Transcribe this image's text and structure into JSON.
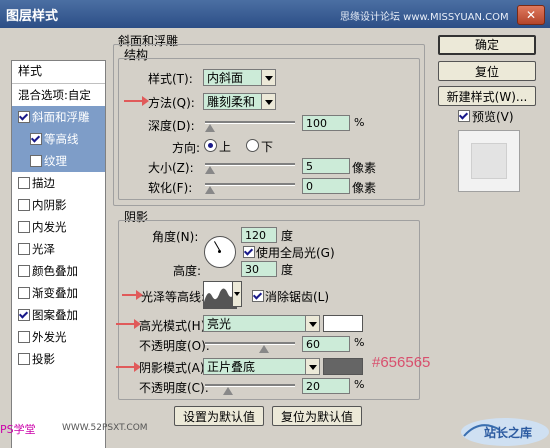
{
  "window": {
    "title": "图层样式",
    "watermark": "思缘设计论坛 www.MISSYUAN.COM"
  },
  "stylelist": {
    "header": "样式",
    "blend_options": "混合选项:自定",
    "items": [
      {
        "label": "斜面和浮雕",
        "checked": true,
        "selected": true,
        "sub": false
      },
      {
        "label": "等高线",
        "checked": true,
        "selected": true,
        "sub": true
      },
      {
        "label": "纹理",
        "checked": false,
        "selected": true,
        "sub": true
      },
      {
        "label": "描边",
        "checked": false,
        "selected": false,
        "sub": false
      },
      {
        "label": "内阴影",
        "checked": false,
        "selected": false,
        "sub": false
      },
      {
        "label": "内发光",
        "checked": false,
        "selected": false,
        "sub": false
      },
      {
        "label": "光泽",
        "checked": false,
        "selected": false,
        "sub": false
      },
      {
        "label": "颜色叠加",
        "checked": false,
        "selected": false,
        "sub": false
      },
      {
        "label": "渐变叠加",
        "checked": false,
        "selected": false,
        "sub": false
      },
      {
        "label": "图案叠加",
        "checked": true,
        "selected": false,
        "sub": false
      },
      {
        "label": "外发光",
        "checked": false,
        "selected": false,
        "sub": false
      },
      {
        "label": "投影",
        "checked": false,
        "selected": false,
        "sub": false
      }
    ]
  },
  "bevel": {
    "section_title": "斜面和浮雕",
    "structure_title": "结构",
    "style_label": "样式(T):",
    "style_value": "内斜面",
    "method_label": "方法(Q):",
    "method_value": "雕刻柔和",
    "depth_label": "深度(D):",
    "depth_value": "100",
    "depth_unit": "%",
    "depth_level": 0.1,
    "direction_label": "方向:",
    "direction_up": "上",
    "direction_down": "下",
    "size_label": "大小(Z):",
    "size_value": "5",
    "size_unit": "像素",
    "soften_label": "软化(F):",
    "soften_value": "0",
    "soften_unit": "像素"
  },
  "shading": {
    "title": "阴影",
    "angle_label": "角度(N):",
    "angle_value": "120",
    "angle_unit": "度",
    "global_light_label": "使用全局光(G)",
    "altitude_label": "高度:",
    "altitude_value": "30",
    "altitude_unit": "度",
    "gloss_contour_label": "光泽等高线:",
    "antialias_label": "消除锯齿(L)",
    "highlight_mode_label": "高光模式(H):",
    "highlight_mode_value": "亮光",
    "highlight_color": "#ffffff",
    "highlight_opacity_label": "不透明度(O):",
    "highlight_opacity_value": "60",
    "shadow_mode_label": "阴影模式(A):",
    "shadow_mode_value": "正片叠底",
    "shadow_color": "#656565",
    "shadow_color_annotation": "#656565",
    "shadow_opacity_label": "不透明度(C):",
    "shadow_opacity_value": "20",
    "percent": "%"
  },
  "buttons": {
    "ok": "确定",
    "reset": "复位",
    "new_style": "新建样式(W)...",
    "preview_label": "预览(V)",
    "make_default": "设置为默认值",
    "reset_default": "复位为默认值"
  },
  "footer": {
    "ps_brand": "PS学堂",
    "url": "WWW.52PSXT.COM",
    "logo": "站长之库"
  },
  "colors": {
    "field_green": "#ccebd8",
    "selection_blue": "#7e9dc8",
    "arrow_red": "#e05a5a"
  }
}
